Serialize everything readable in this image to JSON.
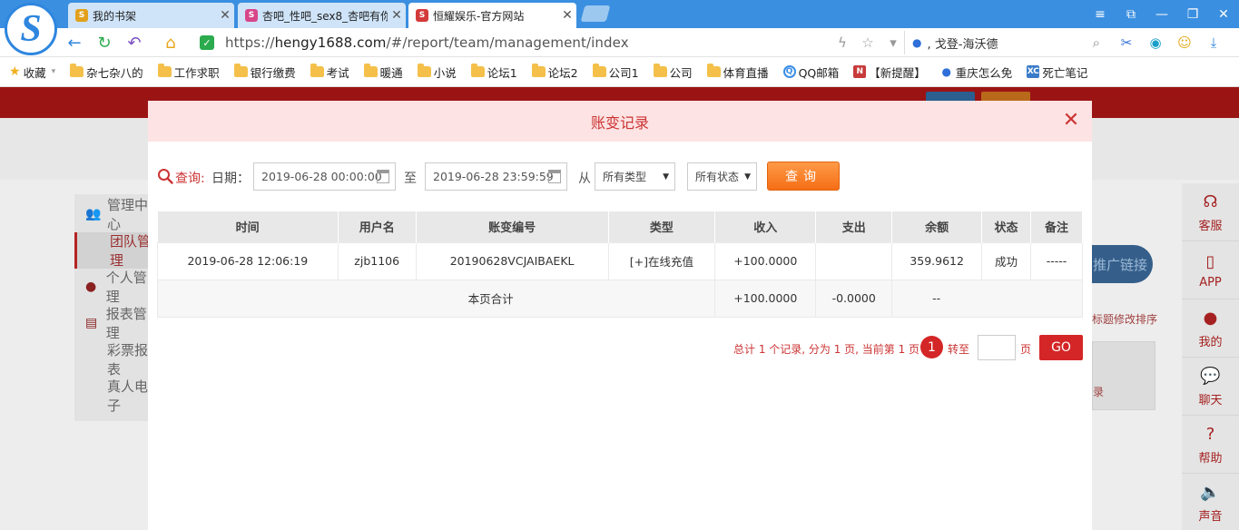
{
  "browser": {
    "tabs": [
      {
        "title": "我的书架",
        "icon": "S",
        "icon_color": "#e2a11d"
      },
      {
        "title": "杏吧_性吧_sex8_杏吧有你",
        "icon": "S",
        "icon_color": "#d8468a"
      },
      {
        "title": "恒耀娱乐-官方网站",
        "icon": "S",
        "icon_color": "#d43a3a"
      }
    ],
    "url": {
      "scheme": "https://",
      "domain": "hengy1688.com",
      "path": "/#/report/team/management/index"
    },
    "search_text": ", 戈登-海沃德",
    "window_controls": [
      "≡",
      "⧉",
      "—",
      "❐",
      "✕"
    ]
  },
  "bookmarks": [
    {
      "label": "收藏",
      "type": "star"
    },
    {
      "label": "杂七杂八的",
      "type": "folder"
    },
    {
      "label": "工作求职",
      "type": "folder"
    },
    {
      "label": "银行缴费",
      "type": "folder"
    },
    {
      "label": "考试",
      "type": "folder"
    },
    {
      "label": "暖通",
      "type": "folder"
    },
    {
      "label": "小说",
      "type": "folder"
    },
    {
      "label": "论坛1",
      "type": "folder"
    },
    {
      "label": "论坛2",
      "type": "folder"
    },
    {
      "label": "公司1",
      "type": "folder"
    },
    {
      "label": "公司",
      "type": "folder"
    },
    {
      "label": "体育直播",
      "type": "folder"
    },
    {
      "label": "QQ邮箱",
      "type": "qq"
    },
    {
      "label": "【新提醒】",
      "type": "news"
    },
    {
      "label": "重庆怎么免",
      "type": "paw"
    },
    {
      "label": "死亡笔记",
      "type": "xc"
    }
  ],
  "page_bg": {
    "sidebar": {
      "section1": "管理中心",
      "active_sub": "团队管理",
      "section2": "个人管理",
      "section3": "报表管理",
      "sub1": "彩票报表",
      "sub2": "真人电子"
    },
    "promo_button": "推广链接",
    "right_note": "标题修改排序",
    "right_link": "录",
    "rightbar": [
      {
        "label": "客服",
        "icon": "headset-icon"
      },
      {
        "label": "APP",
        "icon": "phone-icon"
      },
      {
        "label": "我的",
        "icon": "user-icon"
      },
      {
        "label": "聊天",
        "icon": "chat-icon"
      },
      {
        "label": "帮助",
        "icon": "help-icon"
      },
      {
        "label": "声音",
        "icon": "speaker-icon"
      }
    ]
  },
  "modal": {
    "title": "账变记录",
    "query": {
      "label": "查询:",
      "date_label": "日期：",
      "start_date": "2019-06-28 00:00:00",
      "to_label": "至",
      "end_date": "2019-06-28 23:59:59",
      "from_label": "从",
      "type_select": "所有类型",
      "status_select": "所有状态",
      "button": "查询"
    },
    "table": {
      "headers": [
        "时间",
        "用户名",
        "账变编号",
        "类型",
        "收入",
        "支出",
        "余额",
        "状态",
        "备注"
      ],
      "rows": [
        {
          "time": "2019-06-28 12:06:19",
          "username": "zjb1106",
          "serial": "20190628VCJAIBAEKL",
          "type": "[+]在线充值",
          "income": "+100.0000",
          "expense": "",
          "balance": "359.9612",
          "status": "成功",
          "note": "-----"
        }
      ],
      "summary": {
        "label": "本页合计",
        "income": "+100.0000",
        "expense": "-0.0000",
        "balance": "--"
      }
    },
    "pager": {
      "info": "总计 1 个记录, 分为 1 页, 当前第 1 页",
      "current_page": "1",
      "goto_label": "转至",
      "page_suffix": "页",
      "go_button": "GO"
    }
  }
}
